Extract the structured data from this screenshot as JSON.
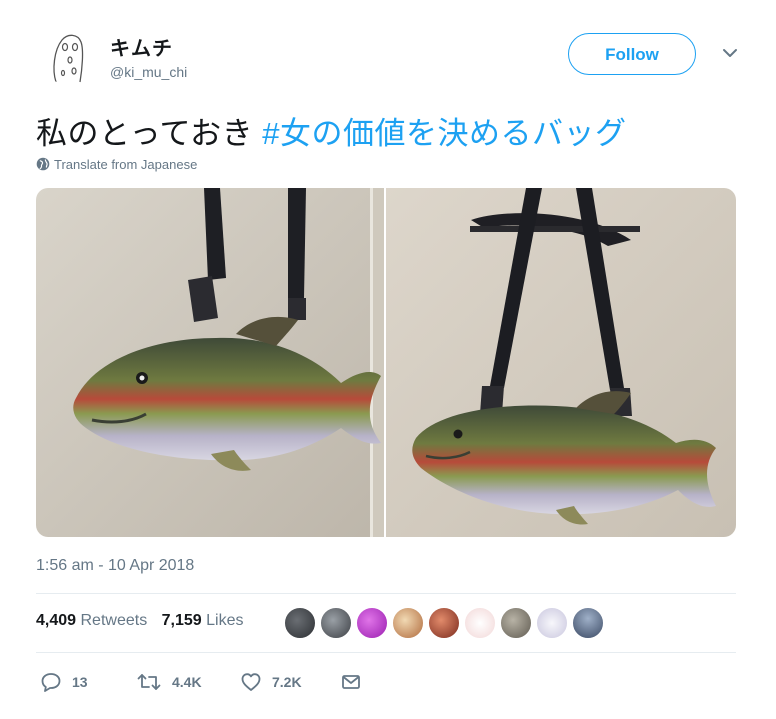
{
  "user": {
    "name": "キムチ",
    "handle": "@ki_mu_chi",
    "follow_label": "Follow"
  },
  "tweet": {
    "text_plain": "私のとっておき ",
    "hashtag": "#女の価値を決めるバッグ",
    "translate_label": "Translate from Japanese",
    "timestamp": "1:56 am - 10 Apr 2018"
  },
  "stats": {
    "retweets_count": "4,409",
    "retweets_label": "Retweets",
    "likes_count": "7,159",
    "likes_label": "Likes"
  },
  "actions": {
    "reply_count": "13",
    "retweet_count": "4.4K",
    "like_count": "7.2K"
  },
  "icons": {
    "more": "chevron-down-icon",
    "translate": "globe-icon",
    "reply": "reply-icon",
    "retweet": "retweet-icon",
    "like": "heart-icon",
    "dm": "envelope-icon"
  },
  "colors": {
    "accent": "#1da1f2",
    "text": "#14171a",
    "muted": "#657786",
    "divider": "#e6ecf0"
  }
}
